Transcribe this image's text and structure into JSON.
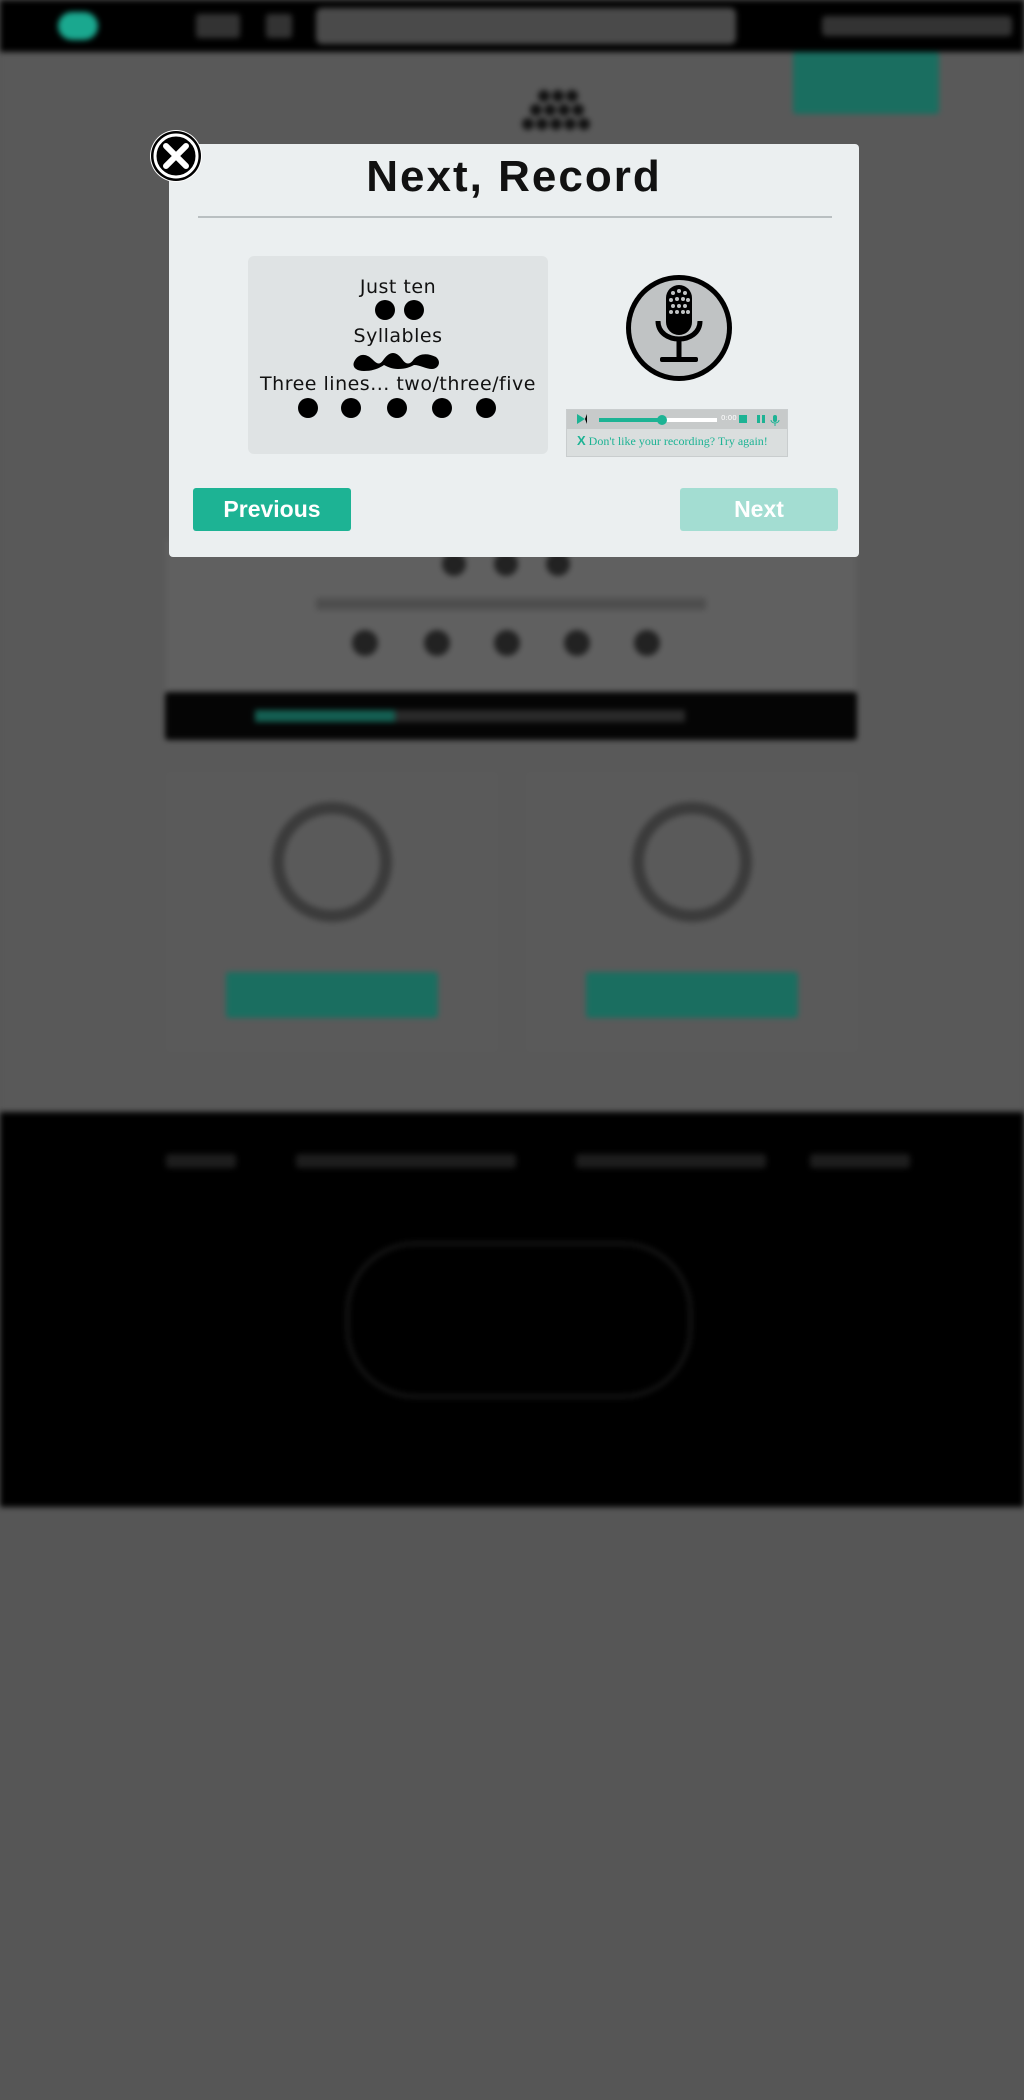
{
  "modal": {
    "title": "Next, Record",
    "example": {
      "line1": "Just ten",
      "line2": "Syllables",
      "line3": "Three lines... two/three/five"
    },
    "player": {
      "time": "0:00",
      "progress": 0.53,
      "retry_x": "X",
      "retry_text": "Don't like your recording? Try again!"
    },
    "previous_label": "Previous",
    "next_label": "Next"
  },
  "colors": {
    "accent": "#1db394",
    "accent_disabled": "#a3ddd2",
    "overlay": "#565656",
    "modal_bg": "#ebeff0"
  },
  "icons": [
    "close-icon",
    "microphone-icon",
    "play-icon",
    "stop-icon",
    "pause-icon",
    "mic-small-icon"
  ]
}
